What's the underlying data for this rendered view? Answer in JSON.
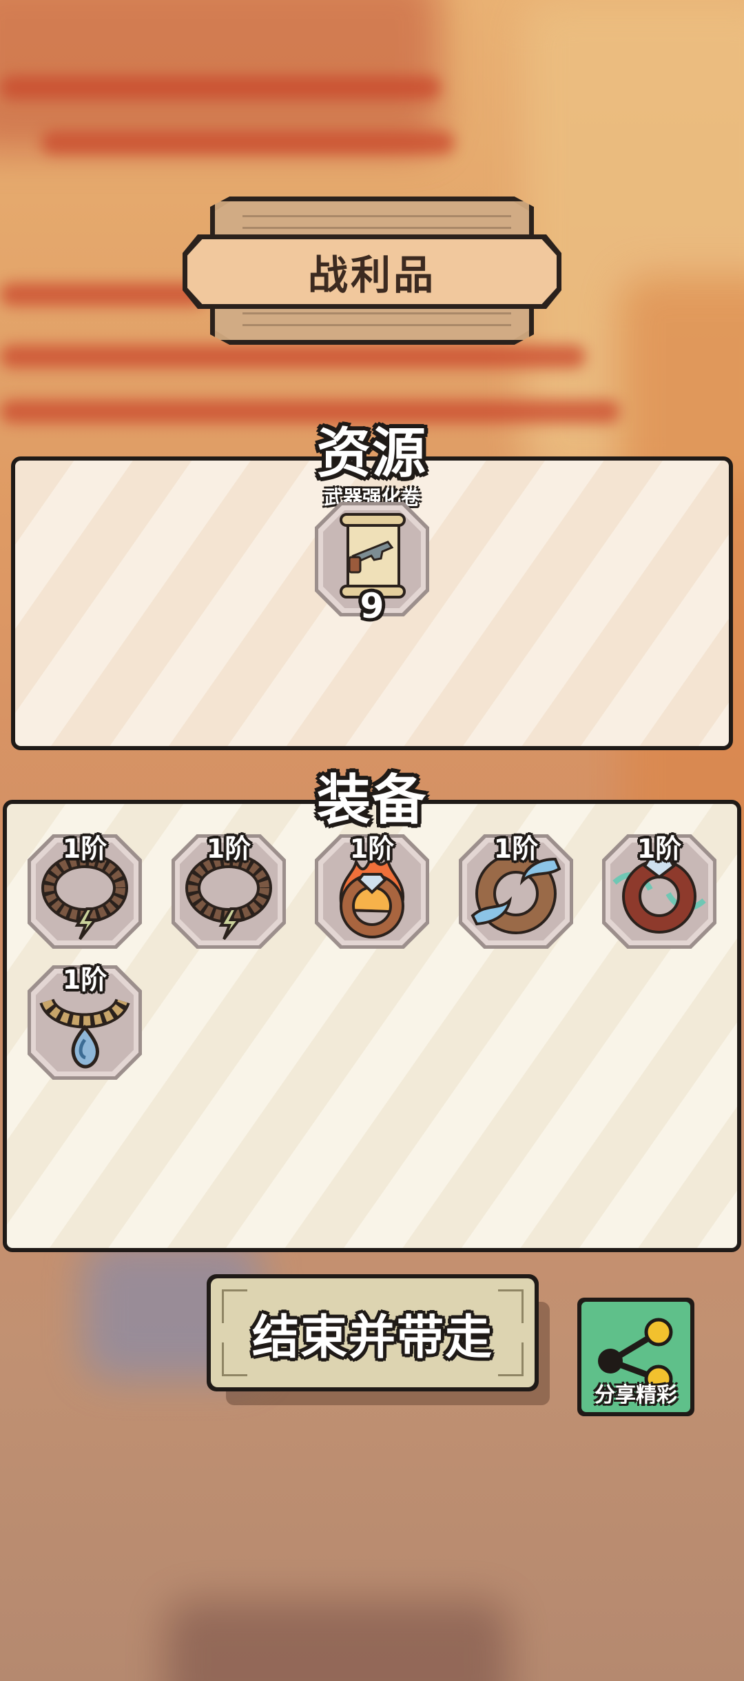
{
  "screen_title": "战利品",
  "resources": {
    "header": "资源",
    "items": [
      {
        "name": "武器强化卷",
        "count": "9",
        "icon": "scroll-gun-icon"
      }
    ]
  },
  "equipment": {
    "header": "装备",
    "items": [
      {
        "tier": "1阶",
        "icon": "bead-necklace-lightning-icon"
      },
      {
        "tier": "1阶",
        "icon": "bead-necklace-lightning-icon"
      },
      {
        "tier": "1阶",
        "icon": "fire-ring-icon"
      },
      {
        "tier": "1阶",
        "icon": "water-ring-icon"
      },
      {
        "tier": "1阶",
        "icon": "wind-ring-icon"
      },
      {
        "tier": "1阶",
        "icon": "water-drop-necklace-icon"
      }
    ]
  },
  "actions": {
    "end_label": "结束并带走",
    "share_label": "分享精彩"
  },
  "colors": {
    "outline": "#1f1a17",
    "banner_fill": "#f1c89d",
    "share_green": "#5fc08a",
    "share_node": "#f2c12e"
  }
}
